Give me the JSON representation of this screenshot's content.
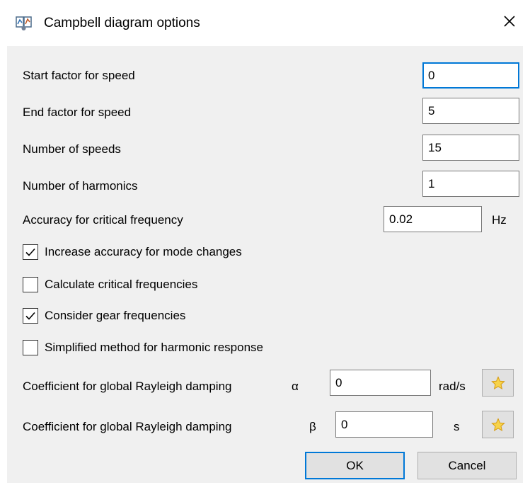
{
  "window": {
    "title": "Campbell diagram options",
    "app_icon": "campbell-app-icon",
    "close_icon": "close-icon"
  },
  "fields": [
    {
      "label": "Start factor for speed",
      "value": "0"
    },
    {
      "label": "End factor for speed",
      "value": "5"
    },
    {
      "label": "Number of speeds",
      "value": "15"
    },
    {
      "label": "Number of harmonics",
      "value": "1"
    }
  ],
  "accuracy": {
    "label": "Accuracy for critical frequency",
    "value": "0.02",
    "unit": "Hz"
  },
  "checkboxes": [
    {
      "label": "Increase accuracy for mode changes",
      "checked": true
    },
    {
      "label": "Calculate critical frequencies",
      "checked": false
    },
    {
      "label": "Consider gear frequencies",
      "checked": true
    },
    {
      "label": "Simplified method for harmonic response",
      "checked": false
    }
  ],
  "damping": [
    {
      "label": "Coefficient for global Rayleigh damping",
      "symbol": "α",
      "value": "0",
      "unit": "rad/s",
      "icon": "star-icon"
    },
    {
      "label": "Coefficient for global Rayleigh damping",
      "symbol": "β",
      "value": "0",
      "unit": "s",
      "icon": "star-icon"
    }
  ],
  "buttons": {
    "ok": "OK",
    "cancel": "Cancel"
  },
  "colors": {
    "accent": "#0078d7",
    "dialog_bg": "#f0f0f0",
    "star": "#f2b21b"
  }
}
